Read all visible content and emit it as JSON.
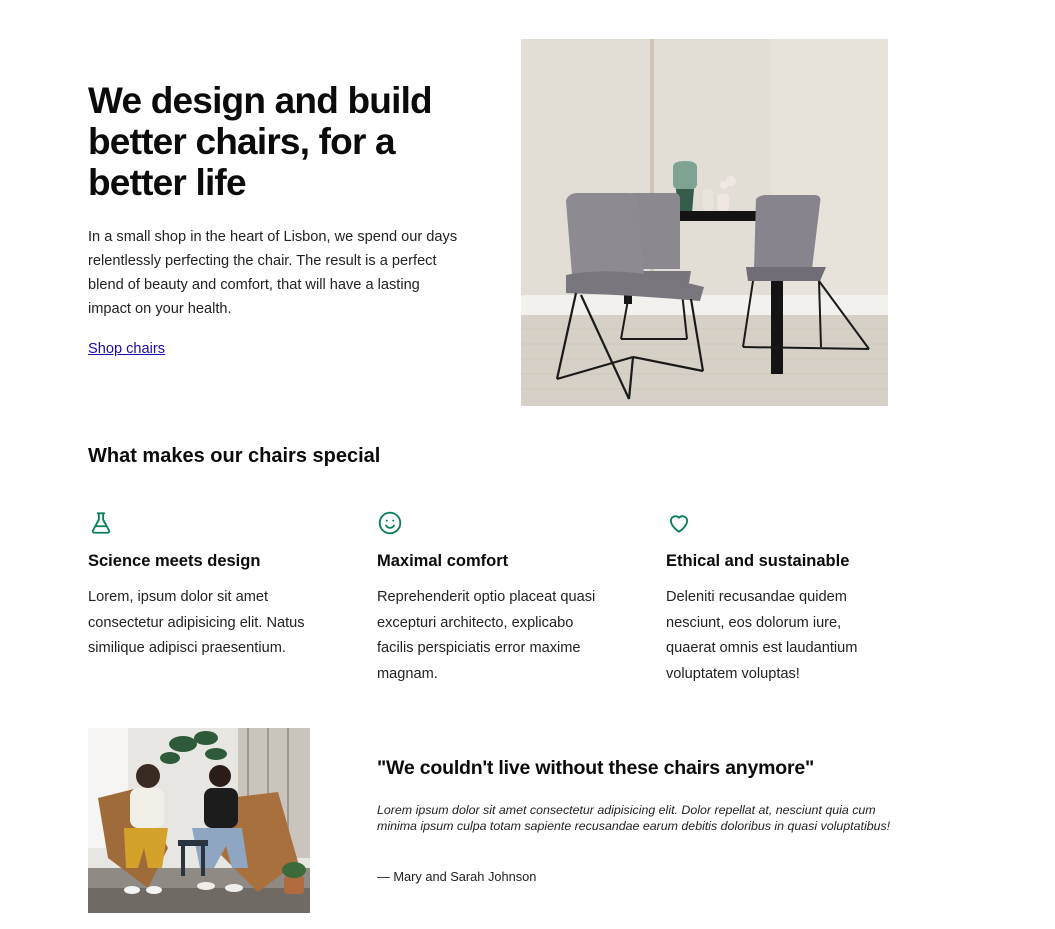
{
  "hero": {
    "title": "We design and build better chairs, for a better life",
    "description": "In a small shop in the heart of Lisbon, we spend our days relentlessly perfecting the chair. The result is a perfect blend of beauty and comfort, that will have a lasting impact on your health.",
    "link_label": "Shop chairs"
  },
  "features": {
    "title": "What makes our chairs special",
    "items": [
      {
        "icon": "beaker-icon",
        "title": "Science meets design",
        "text": "Lorem, ipsum dolor sit amet consectetur adipisicing elit. Natus similique adipisci praesentium."
      },
      {
        "icon": "smiley-icon",
        "title": "Maximal comfort",
        "text": "Reprehenderit optio placeat quasi excepturi architecto, explicabo facilis perspiciatis error maxime magnam."
      },
      {
        "icon": "heart-icon",
        "title": "Ethical and sustainable",
        "text": "Deleniti recusandae quidem nesciunt, eos dolorum iure, quaerat omnis est laudantium voluptatem voluptas!"
      }
    ]
  },
  "testimonial": {
    "quote": "\"We couldn't live without these chairs anymore\"",
    "body": "Lorem ipsum dolor sit amet consectetur adipisicing elit. Dolor repellat at, nesciunt quia cum minima ipsum culpa totam sapiente recusandae earum debitis doloribus in quasi voluptatibus!",
    "author": "— Mary and Sarah Johnson"
  },
  "colors": {
    "accent": "#087f5b",
    "link": "#1a0dab",
    "text": "#111111"
  }
}
